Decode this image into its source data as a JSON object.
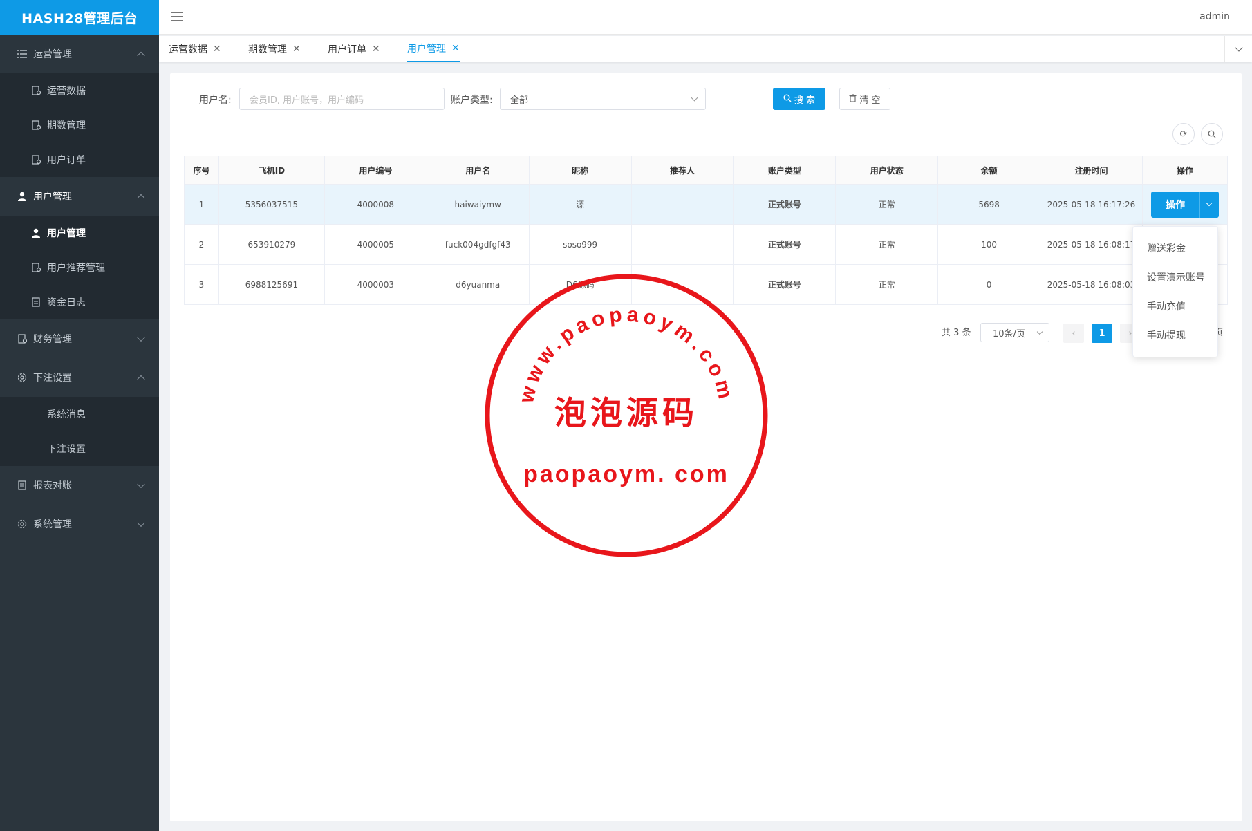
{
  "app": {
    "title": "HASH28管理后台",
    "user": "admin"
  },
  "sidebar": {
    "groups": [
      {
        "label": "运营管理",
        "icon": "list-icon",
        "expanded": true,
        "items": [
          {
            "label": "运营数据"
          },
          {
            "label": "期数管理"
          },
          {
            "label": "用户订单"
          }
        ]
      },
      {
        "label": "用户管理",
        "icon": "user-icon",
        "expanded": true,
        "items": [
          {
            "label": "用户管理",
            "active": true
          },
          {
            "label": "用户推荐管理"
          },
          {
            "label": "资金日志"
          }
        ]
      },
      {
        "label": "财务管理",
        "icon": "document-icon",
        "expanded": false
      },
      {
        "label": "下注设置",
        "icon": "gear-icon",
        "expanded": true,
        "items": [
          {
            "label": "系统消息"
          },
          {
            "label": "下注设置"
          }
        ]
      },
      {
        "label": "报表对账",
        "icon": "report-icon",
        "expanded": false
      },
      {
        "label": "系统管理",
        "icon": "gear-icon",
        "expanded": false
      }
    ]
  },
  "tabs": [
    {
      "label": "运营数据"
    },
    {
      "label": "期数管理"
    },
    {
      "label": "用户订单"
    },
    {
      "label": "用户管理",
      "active": true
    }
  ],
  "search": {
    "username_label": "用户名:",
    "username_placeholder": "会员ID, 用户账号，用户编码",
    "account_type_label": "账户类型:",
    "account_type_value": "全部",
    "search_button": "搜 索",
    "clear_button": "清 空"
  },
  "table": {
    "headers": [
      "序号",
      "飞机ID",
      "用户编号",
      "用户名",
      "昵称",
      "推荐人",
      "账户类型",
      "用户状态",
      "余额",
      "注册时间",
      "操作"
    ],
    "rows": [
      [
        "1",
        "5356037515",
        "4000008",
        "haiwaiymw",
        "源",
        "",
        "正式账号",
        "正常",
        "5698",
        "2025-05-18 16:17:26"
      ],
      [
        "2",
        "653910279",
        "4000005",
        "fuck004gdfgf43",
        "soso999",
        "",
        "正式账号",
        "正常",
        "100",
        "2025-05-18 16:08:17"
      ],
      [
        "3",
        "6988125691",
        "4000003",
        "d6yuanma",
        "D6源码",
        "",
        "正式账号",
        "正常",
        "0",
        "2025-05-18 16:08:03"
      ]
    ],
    "action_label": "操作"
  },
  "pagination": {
    "total": "共 3 条",
    "page_size": "10条/页",
    "current": "1",
    "suffix": "页"
  },
  "action_menu": [
    "赠送彩金",
    "设置演示账号",
    "手动充值",
    "手动提现"
  ],
  "watermark": {
    "top_text": "www.paopaoym.com",
    "center_text": "泡泡源码",
    "bottom_text": "paopaoym. com"
  },
  "colors": {
    "primary": "#0e9ae6",
    "sidebar_bg": "#2b353d",
    "account_green": "#16a34a",
    "stamp_red": "#e8161b"
  }
}
